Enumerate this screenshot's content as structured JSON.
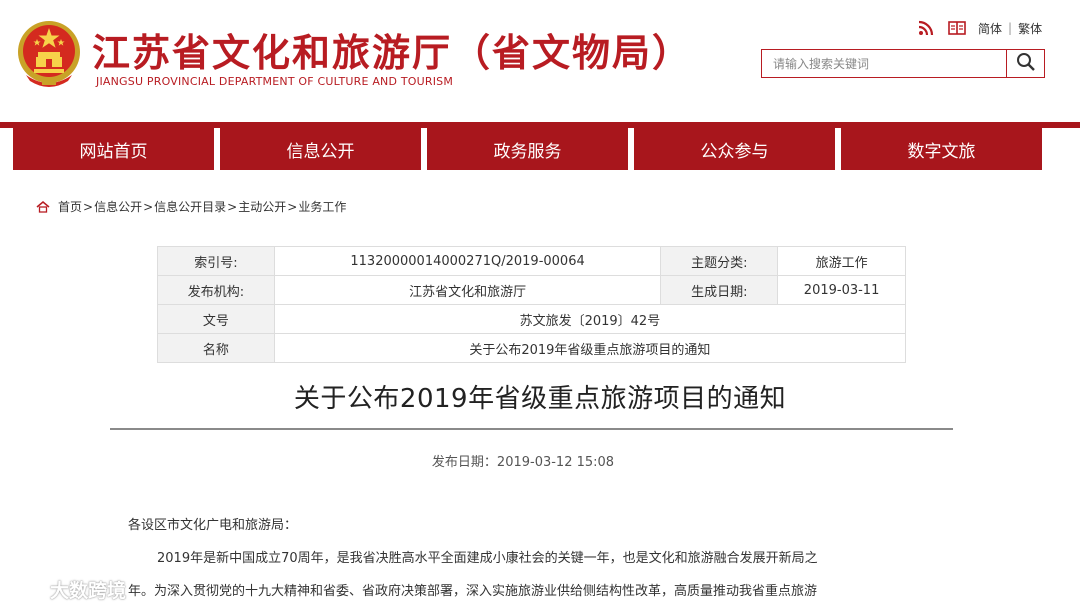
{
  "header": {
    "title": "江苏省文化和旅游厅（省文物局）",
    "subtitle": "JIANGSU PROVINCIAL DEPARTMENT OF CULTURE AND TOURISM",
    "emblem_icon": "national-emblem-icon",
    "links": {
      "simplified": "简体",
      "separator": "|",
      "traditional": "繁体"
    },
    "search": {
      "placeholder": "请输入搜索关键词",
      "icon": "search-icon"
    },
    "accent_color": "#a8161c"
  },
  "nav": {
    "items": [
      {
        "label": "网站首页"
      },
      {
        "label": "信息公开"
      },
      {
        "label": "政务服务"
      },
      {
        "label": "公众参与"
      },
      {
        "label": "数字文旅"
      }
    ]
  },
  "breadcrumb": {
    "items": [
      "首页",
      "信息公开",
      "信息公开目录",
      "主动公开",
      "业务工作"
    ],
    "sep": ">"
  },
  "info_table": {
    "index_label": "索引号:",
    "index_value": "11320000014000271Q/2019-00064",
    "category_label": "主题分类:",
    "category_value": "旅游工作",
    "publisher_label": "发布机构:",
    "publisher_value": "江苏省文化和旅游厅",
    "date_label": "生成日期:",
    "date_value": "2019-03-11",
    "docno_label": "文号",
    "docno_value": "苏文旅发〔2019〕42号",
    "name_label": "名称",
    "name_value": "关于公布2019年省级重点旅游项目的通知"
  },
  "article": {
    "title": "关于公布2019年省级重点旅游项目的通知",
    "pubdate": "发布日期：2019-03-12 15:08",
    "salutation": "各设区市文化广电和旅游局：",
    "para1_line1": "2019年是新中国成立70周年，是我省决胜高水平全面建成小康社会的关键一年，也是文化和旅游融合发展开新局之",
    "para1_line2": "年。为深入贯彻党的十九大精神和省委、省政府决策部署，深入实施旅游业供给侧结构性改革，高质量推动我省重点旅游"
  },
  "watermark": {
    "text": "大数跨境"
  }
}
